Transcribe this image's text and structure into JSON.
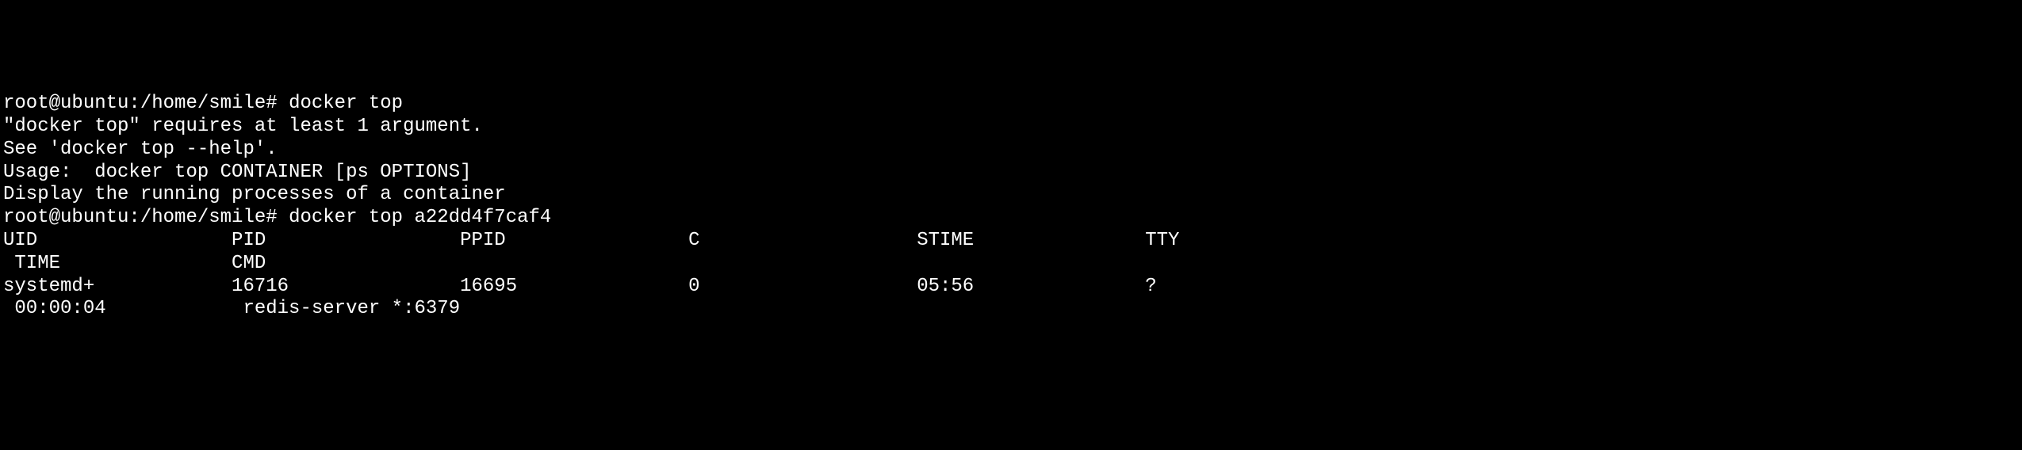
{
  "terminal": {
    "line1_prompt": "root@ubuntu:/home/smile# ",
    "line1_cmd": "docker top",
    "line2": "\"docker top\" requires at least 1 argument.",
    "line3": "See 'docker top --help'.",
    "line4": "",
    "line5": "Usage:  docker top CONTAINER [ps OPTIONS]",
    "line6": "",
    "line7": "Display the running processes of a container",
    "line8_prompt": "root@ubuntu:/home/smile# ",
    "line8_cmd": "docker top a22dd4f7caf4",
    "line9": "UID                 PID                 PPID                C                   STIME               TTY             ",
    "line10": " TIME               CMD",
    "line11": "systemd+            16716               16695               0                   05:56               ?               ",
    "line12": " 00:00:04            redis-server *:6379"
  }
}
